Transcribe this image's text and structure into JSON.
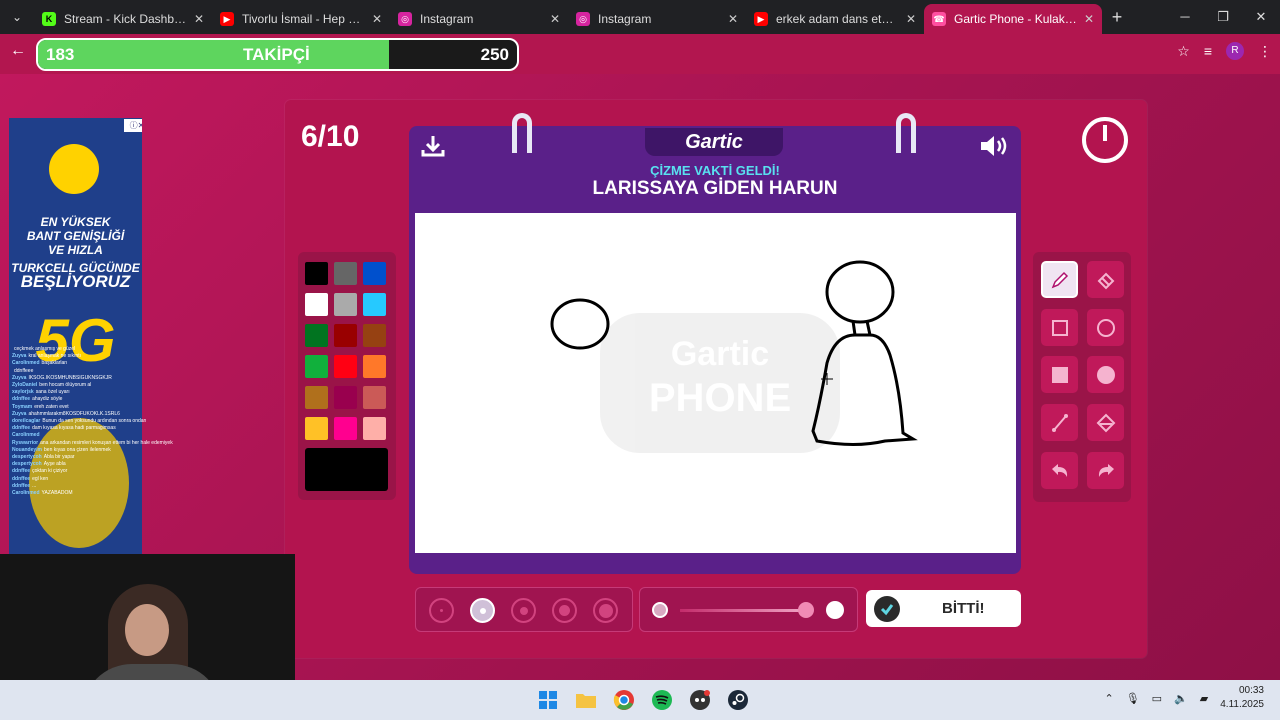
{
  "browser": {
    "tabs": [
      {
        "title": "Stream - Kick Dashboard",
        "favicon": "kick-icon",
        "color": "#53fc18"
      },
      {
        "title": "Tivorlu İsmail - Hep Berabe",
        "favicon": "youtube-icon",
        "color": "#ff0000"
      },
      {
        "title": "Instagram",
        "favicon": "instagram-icon",
        "color": "#d6249f"
      },
      {
        "title": "Instagram",
        "favicon": "instagram-icon",
        "color": "#d6249f"
      },
      {
        "title": "erkek adam dans etmez m",
        "favicon": "youtube-icon",
        "color": "#ff0000"
      },
      {
        "title": "Gartic Phone - Kulaktan Ku",
        "favicon": "phone-icon",
        "color": "#ff4fa0"
      }
    ],
    "profile_initial": "R"
  },
  "follower_goal": {
    "current": "183",
    "label": "TAKİPÇİ",
    "goal": "250",
    "progress": 0.732,
    "color": "#5ed55e"
  },
  "game": {
    "round": "6/10",
    "logo": "Gartic",
    "subtitle": "ÇİZME VAKTİ GELDİ!",
    "prompt": "LARISSAYA GİDEN HARUN",
    "watermark": "Gartic PHONE",
    "done_label": "BİTTİ!",
    "selected_tool": "pencil",
    "selected_size_index": 1,
    "current_color": "#000000"
  },
  "palette": [
    "#000000",
    "#666666",
    "#0050cd",
    "#ffffff",
    "#aaaaaa",
    "#26c9ff",
    "#017420",
    "#990000",
    "#964112",
    "#11b03c",
    "#ff0013",
    "#ff7829",
    "#b0701c",
    "#99004e",
    "#cb5a57",
    "#ffc126",
    "#ff008f",
    "#feafa8"
  ],
  "tools": [
    "pencil-icon",
    "eraser-icon",
    "rectangle-outline-icon",
    "ellipse-outline-icon",
    "rectangle-fill-icon",
    "ellipse-fill-icon",
    "line-icon",
    "bucket-icon",
    "undo-icon",
    "redo-icon"
  ],
  "ad": {
    "line1": "EN YÜKSEK",
    "line2": "BANT GENİŞLİĞİ",
    "line3": "VE HIZLA",
    "line4": "TURKCELL GÜCÜNDE",
    "line5": "BEŞLİYORUZ",
    "big": "5G"
  },
  "chat": [
    {
      "user": "",
      "msg": "ceçkmek anlaşmış ve güzel"
    },
    {
      "user": "Zuyva",
      "msg": "kral anlaşmak ne sıkıntı"
    },
    {
      "user": "Carolinmed",
      "msg": "başaklarları"
    },
    {
      "user": "",
      "msg": "ddnffeee"
    },
    {
      "user": "Zuyva",
      "msg": "İKSOG.İKOSMHUNBSIGUKNSGKJR"
    },
    {
      "user": "ZyloDaniel",
      "msg": "ben hocam ölüyorum al"
    },
    {
      "user": "xaylorjsk",
      "msg": "sana özel uyarı"
    },
    {
      "user": "ddnffee",
      "msg": "ahaydiz söyle"
    },
    {
      "user": "Toymam",
      "msg": "ereh zaten evet"
    },
    {
      "user": "Zuyva",
      "msg": "ahahmmlarakm8KOSDFUKOKLK.1SRL6"
    },
    {
      "user": "doreilcaglar",
      "msg": "Bunun da sen yoksundu ardından sonra ondan"
    },
    {
      "user": "ddnffee",
      "msg": "dam kıyasa kıyasa hadi parmagimsas"
    },
    {
      "user": "Carolinmed",
      "msg": ""
    },
    {
      "user": "Ryswarrior",
      "msg": "ana arkandan resimleri konuşan ettem bi her hale edemiyek"
    },
    {
      "user": "Nouandeyim",
      "msg": "ben kıyas ona çizen ilelenmek"
    },
    {
      "user": "despertycoh",
      "msg": "Abla bir yapar"
    },
    {
      "user": "despertycoh",
      "msg": "Ayşe abla"
    },
    {
      "user": "ddnffee",
      "msg": "çoktan ki çiziyor"
    },
    {
      "user": "ddnffee",
      "msg": "egl ken"
    },
    {
      "user": "ddnffee",
      "msg": "..."
    },
    {
      "user": "Carolinmed",
      "msg": "YAZABADOM"
    }
  ],
  "taskbar": {
    "apps": [
      "windows-start-icon",
      "file-explorer-icon",
      "chrome-icon",
      "spotify-icon",
      "discord-icon",
      "steam-icon"
    ],
    "time": "00:33",
    "date": "4.11.2025"
  }
}
